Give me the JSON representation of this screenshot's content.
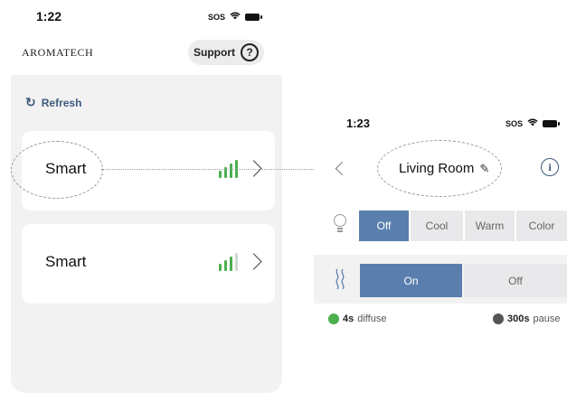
{
  "left_screen": {
    "status": {
      "time": "1:22",
      "sos": "SOS"
    },
    "brand": "AROMATECH",
    "support_label": "Support",
    "refresh_label": "Refresh",
    "devices": [
      {
        "name": "Smart",
        "signal_level": 4
      },
      {
        "name": "Smart",
        "signal_level": 3
      }
    ]
  },
  "right_screen": {
    "status": {
      "time": "1:23",
      "sos": "SOS"
    },
    "room_name": "Living Room",
    "light_modes": [
      "Off",
      "Cool",
      "Warm",
      "Color"
    ],
    "light_selected": "Off",
    "diffuser_modes": [
      "On",
      "Off"
    ],
    "diffuser_selected": "On",
    "diffuse_value": "4s",
    "diffuse_label": "diffuse",
    "pause_value": "300s",
    "pause_label": "pause",
    "colors": {
      "accent": "#5a7fae",
      "diffuse_dot": "#4caf50",
      "pause_dot": "#555555",
      "signal": "#4caf50"
    }
  }
}
